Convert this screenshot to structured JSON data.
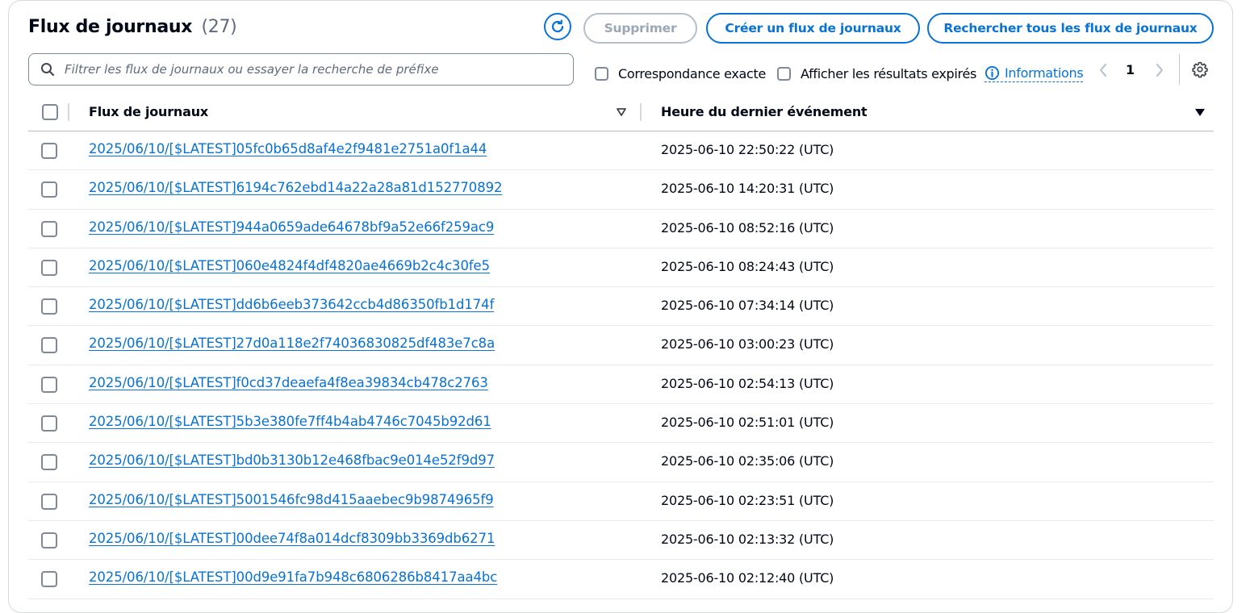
{
  "header": {
    "title": "Flux de journaux",
    "count": "(27)",
    "delete_label": "Supprimer",
    "create_label": "Créer un flux de journaux",
    "search_all_label": "Rechercher tous les flux de journaux"
  },
  "filter": {
    "placeholder": "Filtrer les flux de journaux ou essayer la recherche de préfixe",
    "value": "",
    "exact_match_label": "Correspondance exacte",
    "show_expired_label": "Afficher les résultats expirés",
    "info_label": "Informations"
  },
  "pagination": {
    "current_page": "1"
  },
  "table": {
    "columns": [
      "Flux de journaux",
      "Heure du dernier événement"
    ],
    "rows": [
      {
        "stream": "2025/06/10/[$LATEST]05fc0b65d8af4e2f9481e2751a0f1a44",
        "time": "2025-06-10 22:50:22 (UTC)"
      },
      {
        "stream": "2025/06/10/[$LATEST]6194c762ebd14a22a28a81d152770892",
        "time": "2025-06-10 14:20:31 (UTC)"
      },
      {
        "stream": "2025/06/10/[$LATEST]944a0659ade64678bf9a52e66f259ac9",
        "time": "2025-06-10 08:52:16 (UTC)"
      },
      {
        "stream": "2025/06/10/[$LATEST]060e4824f4df4820ae4669b2c4c30fe5",
        "time": "2025-06-10 08:24:43 (UTC)"
      },
      {
        "stream": "2025/06/10/[$LATEST]dd6b6eeb373642ccb4d86350fb1d174f",
        "time": "2025-06-10 07:34:14 (UTC)"
      },
      {
        "stream": "2025/06/10/[$LATEST]27d0a118e2f74036830825df483e7c8a",
        "time": "2025-06-10 03:00:23 (UTC)"
      },
      {
        "stream": "2025/06/10/[$LATEST]f0cd37deaefa4f8ea39834cb478c2763",
        "time": "2025-06-10 02:54:13 (UTC)"
      },
      {
        "stream": "2025/06/10/[$LATEST]5b3e380fe7ff4b4ab4746c7045b92d61",
        "time": "2025-06-10 02:51:01 (UTC)"
      },
      {
        "stream": "2025/06/10/[$LATEST]bd0b3130b12e468fbac9e014e52f9d97",
        "time": "2025-06-10 02:35:06 (UTC)"
      },
      {
        "stream": "2025/06/10/[$LATEST]5001546fc98d415aaebec9b9874965f9",
        "time": "2025-06-10 02:23:51 (UTC)"
      },
      {
        "stream": "2025/06/10/[$LATEST]00dee74f8a014dcf8309bb3369db6271",
        "time": "2025-06-10 02:13:32 (UTC)"
      },
      {
        "stream": "2025/06/10/[$LATEST]00d9e91fa7b948c6806286b8417aa4bc",
        "time": "2025-06-10 02:12:40 (UTC)"
      }
    ]
  },
  "icons": {
    "refresh": "refresh-icon",
    "search": "search-icon",
    "info": "info-icon",
    "prev": "chevron-left-icon",
    "next": "chevron-right-icon",
    "settings": "gear-icon",
    "sort_stream": "sort-caret-outline-icon",
    "sort_time": "sort-caret-filled-icon"
  },
  "colors": {
    "accent": "#0972d3",
    "disabled": "#9ba7b6",
    "text": "#000716"
  }
}
